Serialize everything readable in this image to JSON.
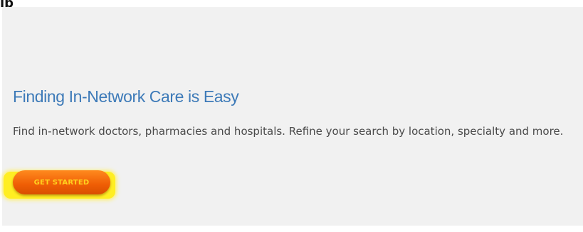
{
  "page": {
    "top_fragment": "lp"
  },
  "card": {
    "title": "Finding In-Network Care is Easy",
    "description": "Find in-network doctors, pharmacies and hospitals. Refine your search by location, specialty and more.",
    "cta_label": "GET STARTED"
  },
  "colors": {
    "title": "#3d7ab8",
    "button": "#ef5d05",
    "button_text": "#ffd21e",
    "highlight": "#ffee22",
    "card_background": "#f1f1f1"
  }
}
